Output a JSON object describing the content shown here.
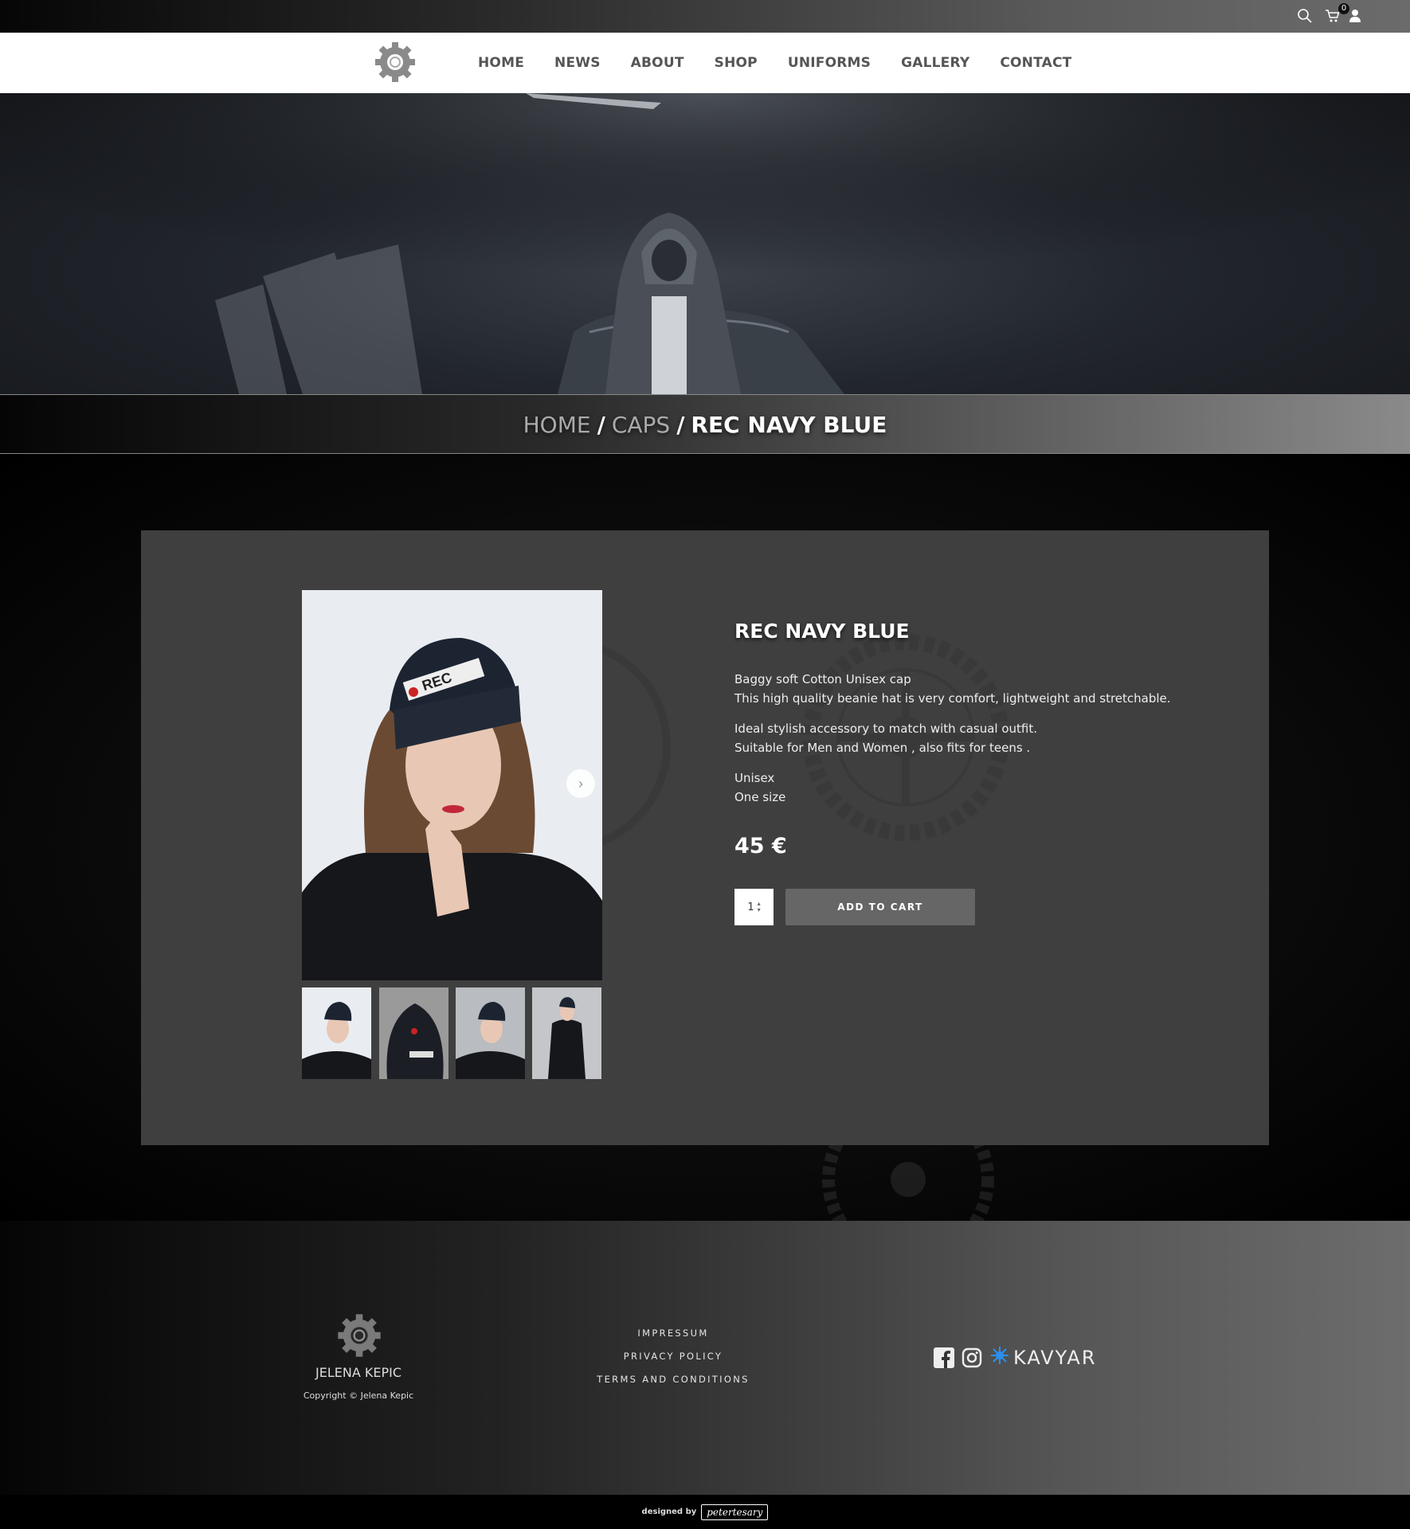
{
  "topbar": {
    "cart_count": "0",
    "icons": [
      "search-icon",
      "cart-icon",
      "user-icon"
    ]
  },
  "nav": {
    "logo": "gear-logo",
    "items": [
      {
        "label": "HOME"
      },
      {
        "label": "NEWS"
      },
      {
        "label": "ABOUT"
      },
      {
        "label": "SHOP"
      },
      {
        "label": "UNIFORMS"
      },
      {
        "label": "GALLERY"
      },
      {
        "label": "CONTACT"
      }
    ]
  },
  "breadcrumb": {
    "home": "HOME",
    "sep": "/",
    "category": "CAPS",
    "current": "REC NAVY BLUE"
  },
  "product": {
    "title": "REC NAVY BLUE",
    "desc_lines": [
      "Baggy soft Cotton Unisex cap",
      "This high quality beanie hat is very comfort, lightweight and stretchable.",
      "Ideal stylish accessory to match with casual outfit.",
      "Suitable for Men and Women , also fits for teens .",
      "Unisex",
      "One size"
    ],
    "price": "45 €",
    "quantity": "1",
    "add_to_cart": "ADD TO CART",
    "beanie_logo": "REC"
  },
  "footer": {
    "name": "JELENA KEPIC",
    "copyright": "Copyright © Jelena Kepic",
    "links": [
      "IMPRESSUM",
      "PRIVACY POLICY",
      "TERMS AND CONDITIONS"
    ],
    "kavyar": "KAVYAR",
    "designed_by": "designed by",
    "designer_signature": "petertesary"
  },
  "colors": {
    "panel": "#3f3f3f",
    "button": "#666666",
    "nav_text": "#555555"
  }
}
